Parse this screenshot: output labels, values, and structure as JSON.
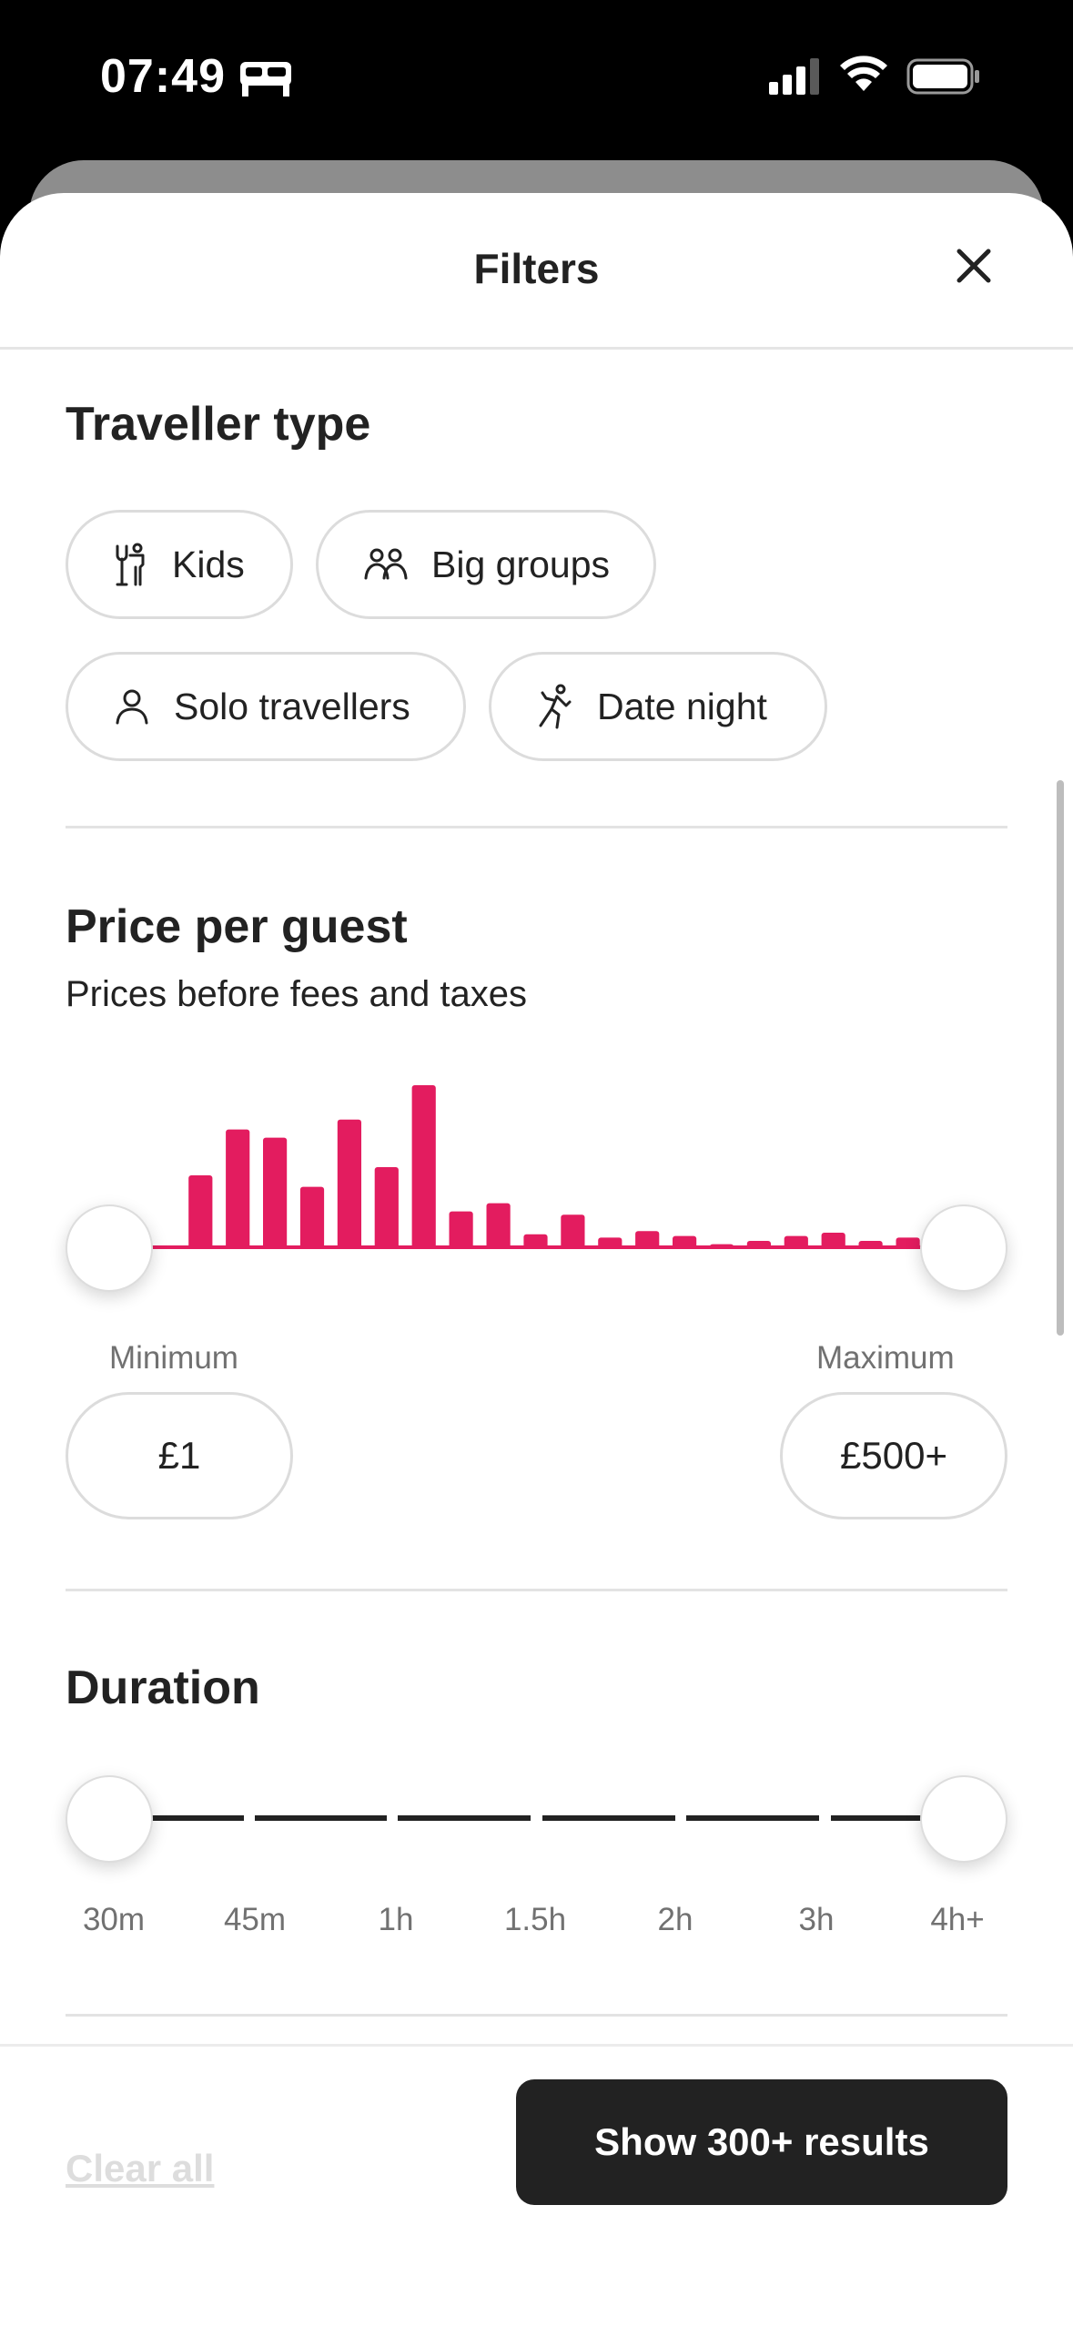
{
  "status_bar": {
    "time": "07:49",
    "icons": [
      "bed-icon",
      "cellular-signal-icon",
      "wifi-icon",
      "battery-icon"
    ]
  },
  "sheet": {
    "title": "Filters",
    "close_icon": "close-icon"
  },
  "traveller_type": {
    "title": "Traveller type",
    "chips": [
      {
        "label": "Kids",
        "icon": "kids-icon"
      },
      {
        "label": "Big groups",
        "icon": "big-groups-icon"
      },
      {
        "label": "Solo travellers",
        "icon": "person-icon"
      },
      {
        "label": "Date night",
        "icon": "dancing-icon"
      }
    ]
  },
  "price": {
    "title": "Price per guest",
    "subtitle": "Prices before fees and taxes",
    "min_label": "Minimum",
    "max_label": "Maximum",
    "min_value": "£1",
    "max_value": "£500+",
    "accent_color": "#E31C5F",
    "histogram_relative_heights": [
      0.0,
      0.02,
      0.45,
      0.73,
      0.68,
      0.38,
      0.79,
      0.5,
      1.0,
      0.23,
      0.28,
      0.09,
      0.21,
      0.07,
      0.11,
      0.08,
      0.03,
      0.05,
      0.08,
      0.1,
      0.05,
      0.07
    ],
    "range_selected_min_fraction": 0.0,
    "range_selected_max_fraction": 1.0
  },
  "duration": {
    "title": "Duration",
    "ticks": [
      "30m",
      "45m",
      "1h",
      "1.5h",
      "2h",
      "3h",
      "4h+"
    ],
    "range_selected_min_fraction": 0.0,
    "range_selected_max_fraction": 1.0
  },
  "footer": {
    "clear_all": "Clear all",
    "show_results": "Show 300+ results"
  }
}
